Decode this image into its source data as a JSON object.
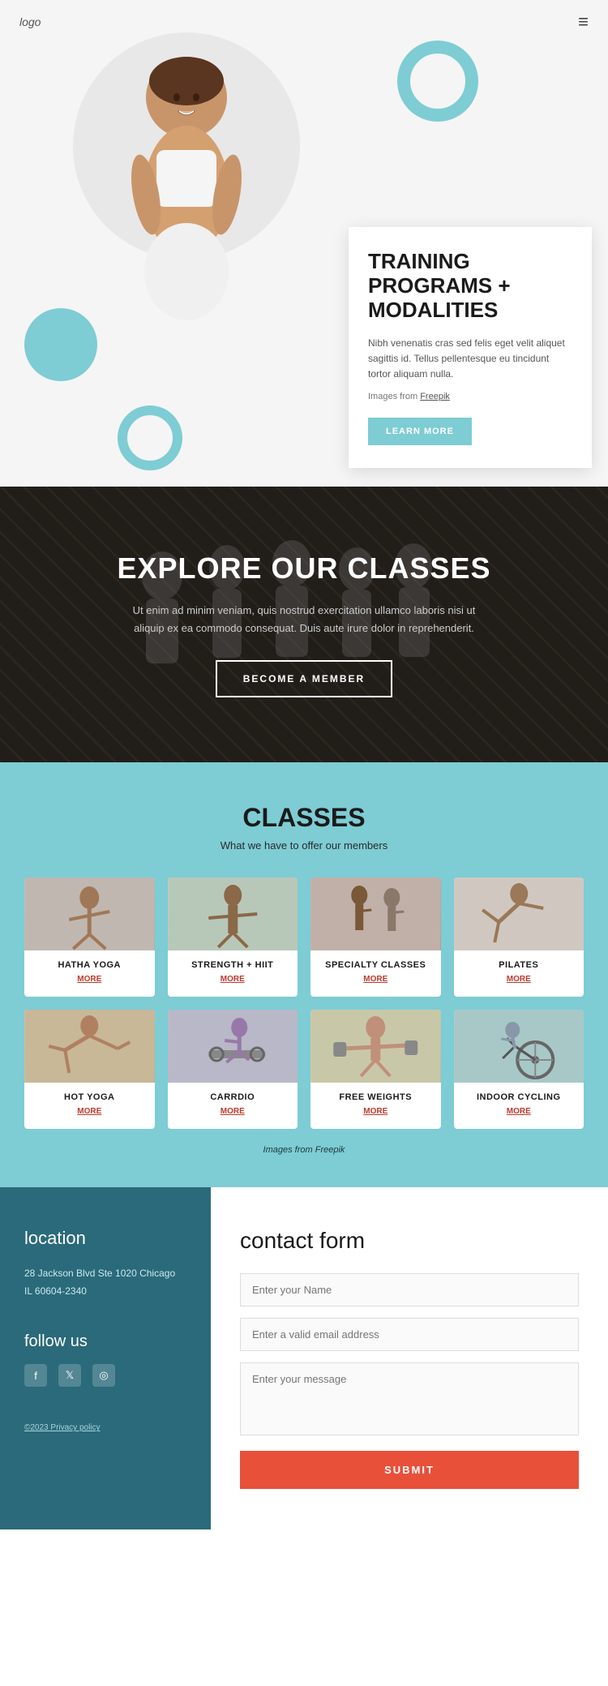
{
  "header": {
    "logo": "logo",
    "menu_icon": "≡"
  },
  "hero": {
    "title_line1": "TRAINING",
    "title_line2": "PROGRAMS +",
    "title_line3": "MODALITIES",
    "description": "Nibh venenatis cras sed felis eget velit aliquet sagittis id. Tellus pellentesque eu tincidunt tortor aliquam nulla.",
    "images_from_label": "Images from",
    "images_from_link": "Freepik",
    "learn_more": "LEARN MORE"
  },
  "explore": {
    "title": "EXPLORE OUR CLASSES",
    "description": "Ut enim ad minim veniam, quis nostrud exercitation ullamco laboris nisi ut aliquip ex ea commodo consequat. Duis aute irure dolor in reprehenderit.",
    "become_member": "BECOME A MEMBER"
  },
  "classes": {
    "title": "CLASSES",
    "subtitle": "What we have to offer our members",
    "images_from_label": "Images from",
    "images_from_link": "Freepik",
    "items": [
      {
        "id": "hatha-yoga",
        "name": "HATHA YOGA",
        "more": "MORE",
        "color": "img-hatha"
      },
      {
        "id": "strength-hiit",
        "name": "STRENGTH + HIIT",
        "more": "MORE",
        "color": "img-strength"
      },
      {
        "id": "specialty",
        "name": "SPECIALTY CLASSES",
        "more": "MORE",
        "color": "img-specialty"
      },
      {
        "id": "pilates",
        "name": "PILATES",
        "more": "MORE",
        "color": "img-pilates"
      },
      {
        "id": "hot-yoga",
        "name": "HOT YOGA",
        "more": "MORE",
        "color": "img-hot-yoga"
      },
      {
        "id": "cardio",
        "name": "CARRDIO",
        "more": "MORE",
        "color": "img-cardio"
      },
      {
        "id": "free-weights",
        "name": "FREE WEIGHTS",
        "more": "MORE",
        "color": "img-free-weights"
      },
      {
        "id": "indoor-cycling",
        "name": "INDOOR CYCLING",
        "more": "MORE",
        "color": "img-indoor-cycling"
      }
    ]
  },
  "location": {
    "title": "location",
    "address_line1": "28 Jackson Blvd Ste 1020 Chicago",
    "address_line2": "IL 60604-2340",
    "follow_us": "follow us",
    "copyright": "©2023 Privacy policy"
  },
  "contact": {
    "title": "contact form",
    "name_placeholder": "Enter your Name",
    "email_placeholder": "Enter a valid email address",
    "message_placeholder": "Enter your message",
    "submit": "SUBMIT"
  }
}
